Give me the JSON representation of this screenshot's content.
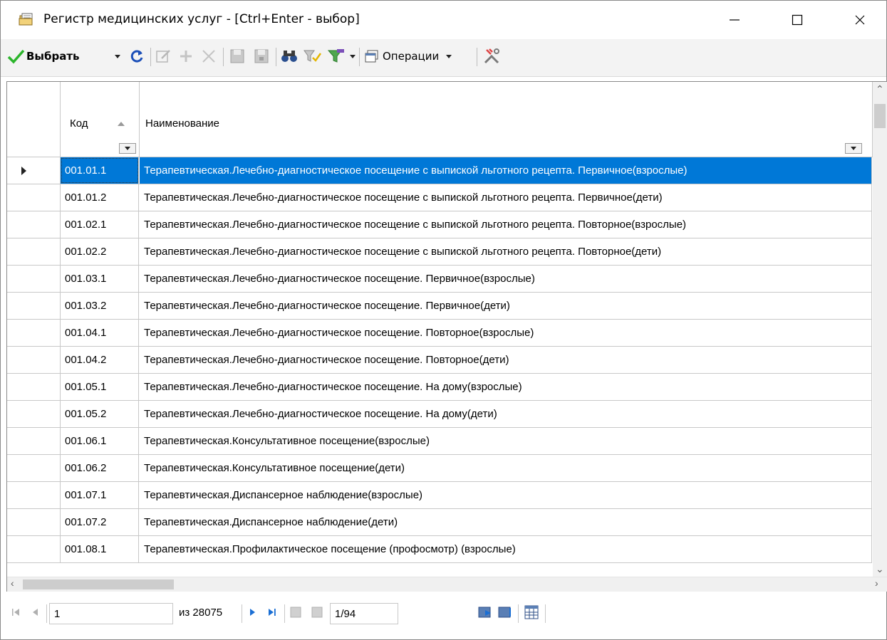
{
  "window": {
    "title": "Регистр медицинских услуг - [Ctrl+Enter - выбор]"
  },
  "toolbar": {
    "select_label": "Выбрать",
    "operations_label": "Операции",
    "icons": [
      "refresh-icon",
      "edit-icon",
      "add-icon",
      "delete-icon",
      "save-icon",
      "save-all-icon",
      "find-icon",
      "filter-icon",
      "filter-clear-icon",
      "operations-icon",
      "tools-icon"
    ]
  },
  "grid": {
    "columns": {
      "code": "Код",
      "name": "Наименование"
    },
    "sort": {
      "column": "code",
      "direction": "ascending"
    },
    "selected_row": 0,
    "rows": [
      {
        "code": "001.01.1",
        "name": "Терапевтическая.Лечебно-диагностическое посещение с выпиской льготного рецепта. Первичное(взрослые)"
      },
      {
        "code": "001.01.2",
        "name": "Терапевтическая.Лечебно-диагностическое посещение с выпиской льготного рецепта. Первичное(дети)"
      },
      {
        "code": "001.02.1",
        "name": "Терапевтическая.Лечебно-диагностическое посещение с выпиской льготного рецепта. Повторное(взрослые)"
      },
      {
        "code": "001.02.2",
        "name": "Терапевтическая.Лечебно-диагностическое посещение с выпиской льготного рецепта. Повторное(дети)"
      },
      {
        "code": "001.03.1",
        "name": "Терапевтическая.Лечебно-диагностическое посещение. Первичное(взрослые)"
      },
      {
        "code": "001.03.2",
        "name": "Терапевтическая.Лечебно-диагностическое посещение. Первичное(дети)"
      },
      {
        "code": "001.04.1",
        "name": "Терапевтическая.Лечебно-диагностическое посещение. Повторное(взрослые)"
      },
      {
        "code": "001.04.2",
        "name": "Терапевтическая.Лечебно-диагностическое посещение. Повторное(дети)"
      },
      {
        "code": "001.05.1",
        "name": "Терапевтическая.Лечебно-диагностическое посещение. На дому(взрослые)"
      },
      {
        "code": "001.05.2",
        "name": "Терапевтическая.Лечебно-диагностическое посещение. На дому(дети)"
      },
      {
        "code": "001.06.1",
        "name": "Терапевтическая.Консультативное посещение(взрослые)"
      },
      {
        "code": "001.06.2",
        "name": "Терапевтическая.Консультативное посещение(дети)"
      },
      {
        "code": "001.07.1",
        "name": "Терапевтическая.Диспансерное наблюдение(взрослые)"
      },
      {
        "code": "001.07.2",
        "name": "Терапевтическая.Диспансерное наблюдение(дети)"
      },
      {
        "code": "001.08.1",
        "name": "Терапевтическая.Профилактическое посещение (профосмотр) (взрослые)"
      }
    ]
  },
  "navigator": {
    "record_value": "1",
    "record_total": "из 28075",
    "page_value": "1/94"
  },
  "colors": {
    "selection": "#0078d7",
    "toolbar_bg": "#f3f3f3"
  }
}
